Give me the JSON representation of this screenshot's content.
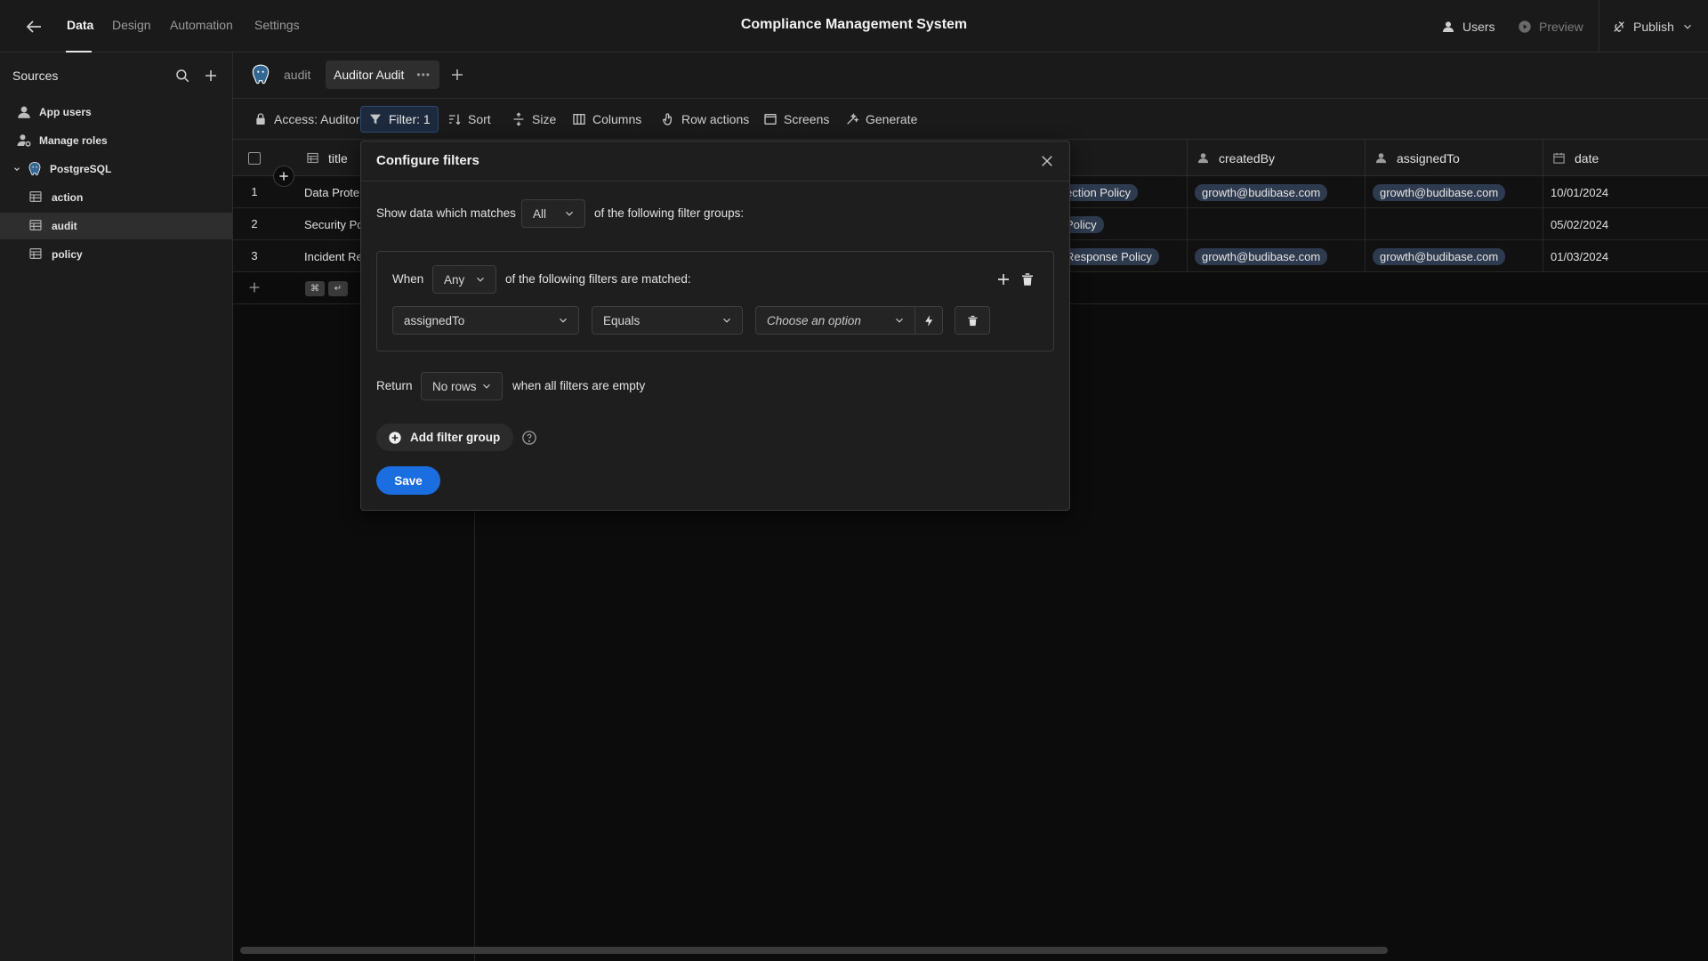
{
  "topbar": {
    "nav_tabs": [
      "Data",
      "Design",
      "Automation",
      "Settings"
    ],
    "active_tab": "Data",
    "app_title": "Compliance Management System",
    "users_label": "Users",
    "preview_label": "Preview",
    "publish_label": "Publish"
  },
  "sidebar": {
    "title": "Sources",
    "items": [
      {
        "label": "App users",
        "icon": "user-icon"
      },
      {
        "label": "Manage roles",
        "icon": "roles-icon"
      },
      {
        "label": "PostgreSQL",
        "icon": "postgresql-icon"
      },
      {
        "label": "action",
        "icon": "table-icon"
      },
      {
        "label": "audit",
        "icon": "table-icon",
        "selected": true
      },
      {
        "label": "policy",
        "icon": "table-icon"
      }
    ]
  },
  "subheader": {
    "table_tab": "audit",
    "view_tab": "Auditor Audit"
  },
  "toolbar": {
    "access": "Access: Auditor",
    "filter": "Filter: 1",
    "sort": "Sort",
    "size": "Size",
    "columns": "Columns",
    "row_actions": "Row actions",
    "screens": "Screens",
    "generate": "Generate"
  },
  "grid": {
    "columns": {
      "title": "title",
      "created_by": "createdBy",
      "assigned_to": "assignedTo",
      "date": "date"
    },
    "rows": [
      {
        "num": "1",
        "title": "Data Prote",
        "policy": "ection Policy",
        "created_by": "growth@budibase.com",
        "assigned_to": "growth@budibase.com",
        "date": "10/01/2024"
      },
      {
        "num": "2",
        "title": "Security Po",
        "policy": "Policy",
        "created_by": "",
        "assigned_to": "",
        "date": "05/02/2024"
      },
      {
        "num": "3",
        "title": "Incident Re",
        "policy": "Response Policy",
        "created_by": "growth@budibase.com",
        "assigned_to": "growth@budibase.com",
        "date": "01/03/2024"
      }
    ],
    "kbd": [
      "⌘",
      "↵"
    ]
  },
  "modal": {
    "title": "Configure filters",
    "show_prefix": "Show data which matches",
    "match_all": "All",
    "show_suffix": "of the following filter groups:",
    "when": "When",
    "match_any": "Any",
    "when_suffix": "of the following filters are matched:",
    "filter_field": "assignedTo",
    "filter_operator": "Equals",
    "filter_value_placeholder": "Choose an option",
    "return_label": "Return",
    "return_value": "No rows",
    "return_suffix": "when all filters are empty",
    "add_group": "Add filter group",
    "save": "Save"
  },
  "colors": {
    "accent": "#1a6ee0",
    "pill": "#2e3a4e",
    "background": "#0c0c0c",
    "panel": "#1a1a1a"
  }
}
